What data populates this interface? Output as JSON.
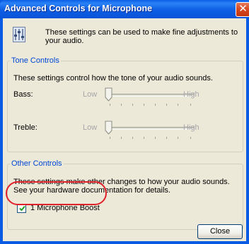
{
  "window": {
    "title": "Advanced Controls for Microphone",
    "close_glyph": "✕"
  },
  "header": {
    "icon": "mixer-icon",
    "text": "These settings can be used to make fine adjustments to your audio."
  },
  "tone_controls": {
    "legend": "Tone Controls",
    "description": "These settings control how the tone of your audio sounds.",
    "sliders": [
      {
        "label": "Bass:",
        "low": "Low",
        "high": "High",
        "level": 0.0
      },
      {
        "label": "Treble:",
        "low": "Low",
        "high": "High",
        "level": 0.0
      }
    ]
  },
  "other_controls": {
    "legend": "Other Controls",
    "description": "These settings make other changes to how your audio sounds.  See your hardware documentation for details.",
    "checkbox": {
      "label": "1  Microphone Boost",
      "checked": true
    }
  },
  "buttons": {
    "close_label": "Close"
  },
  "colors": {
    "legend": "#0046d5",
    "highlight_ring": "#e0202a",
    "titlebar": "#0a5be3"
  }
}
